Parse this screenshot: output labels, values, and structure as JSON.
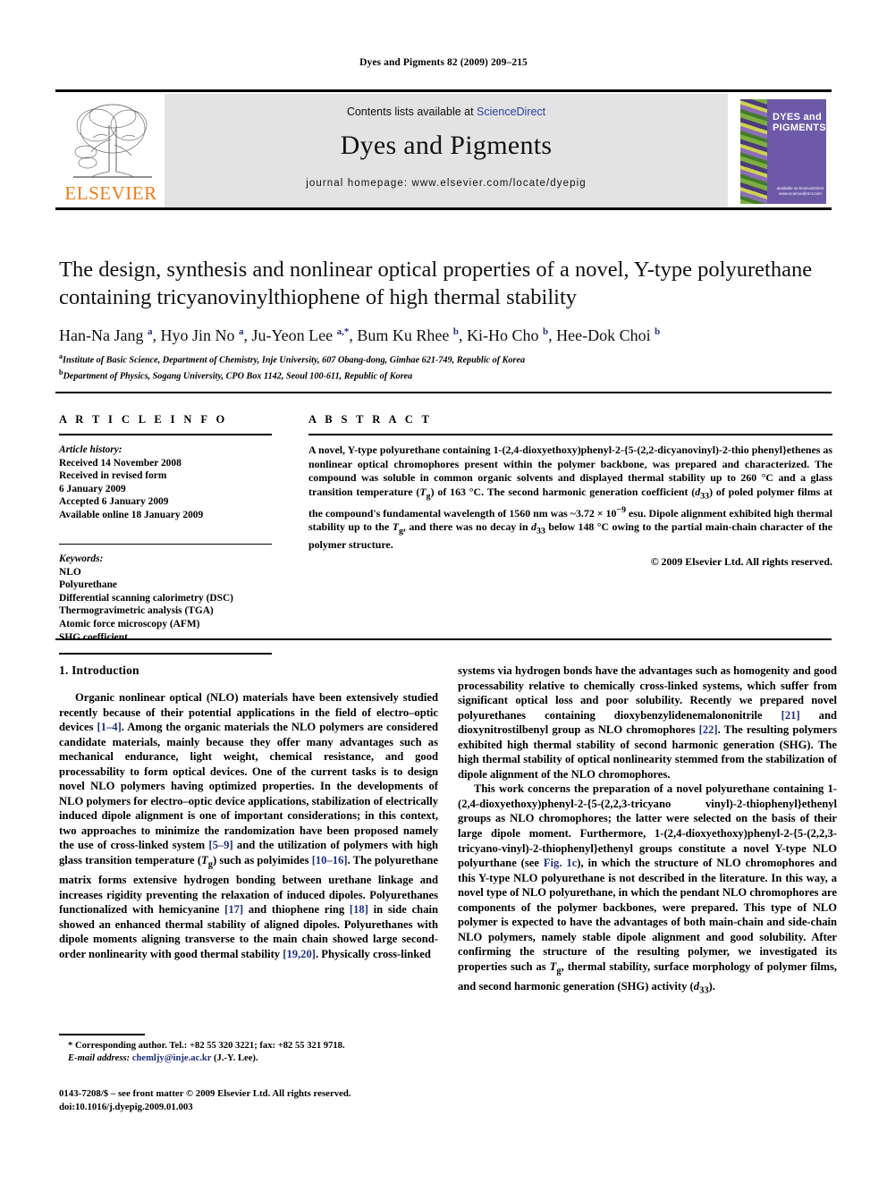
{
  "running_head": "Dyes and Pigments 82 (2009) 209–215",
  "masthead": {
    "contents_prefix": "Contents lists available at ",
    "sciencedirect": "ScienceDirect",
    "journal_name": "Dyes and Pigments",
    "homepage": "journal homepage: www.elsevier.com/locate/dyepig",
    "publisher_logo_text": "ELSEVIER",
    "cover_title": "DYES and PIGMENTS",
    "cover_sd_text": "available at ScienceDirect www.sciencedirect.com",
    "colors": {
      "sciencedirect_link": "#2b3fa0",
      "elsevier_orange": "#ef7c1a",
      "cover_purple": "#6c5aa8",
      "masthead_background": "#e3e3e3"
    }
  },
  "article": {
    "title": "The design, synthesis and nonlinear optical properties of a novel, Y-type polyurethane containing tricyanovinylthiophene of high thermal stability",
    "authors_html": "Han-Na Jang <sup>a</sup>, Hyo Jin No <sup>a</sup>, Ju-Yeon Lee <sup>a,*</sup>, Bum Ku Rhee <sup>b</sup>, Ki-Ho Cho <sup>b</sup>, Hee-Dok Choi <sup>b</sup>",
    "affiliation_a": "Institute of Basic Science, Department of Chemistry, Inje University, 607 Obang-dong, Gimhae 621-749, Republic of Korea",
    "affiliation_b": "Department of Physics, Sogang University, CPO Box 1142, Seoul 100-611, Republic of Korea"
  },
  "article_info": {
    "heading": "A R T I C L E    I N F O",
    "history_label": "Article history:",
    "history": [
      "Received 14 November 2008",
      "Received in revised form",
      "6 January 2009",
      "Accepted 6 January 2009",
      "Available online 18 January 2009"
    ],
    "keywords_label": "Keywords:",
    "keywords": [
      "NLO",
      "Polyurethane",
      "Differential scanning calorimetry (DSC)",
      "Thermogravimetric analysis (TGA)",
      "Atomic force microscopy (AFM)",
      "SHG coefficient"
    ]
  },
  "abstract": {
    "heading": "A B S T R A C T",
    "text_html": "A novel, Y-type polyurethane containing 1-(2,4-dioxyethoxy)phenyl-2-{5-(2,2-dicyanovinyl)-2-thio phenyl}ethenes as nonlinear optical chromophores present within the polymer backbone, was prepared and characterized. The compound was soluble in common organic solvents and displayed thermal stability up to 260 °C and a glass transition temperature (<em>T</em><sub>g</sub>) of 163 °C. The second harmonic generation coefficient (<em>d</em><sub>33</sub>) of poled polymer films at the compound's fundamental wavelength of 1560 nm was ~3.72 × 10<sup>−9</sup> esu. Dipole alignment exhibited high thermal stability up to the <em>T</em><sub>g</sub>, and there was no decay in <em>d</em><sub>33</sub> below 148 °C owing to the partial main-chain character of the polymer structure.",
    "copyright": "© 2009 Elsevier Ltd. All rights reserved."
  },
  "body": {
    "section_heading": "1.  Introduction",
    "left_paragraph_1_html": "Organic nonlinear optical (NLO) materials have been extensively studied recently because of their potential applications in the field of electro–optic devices <span class=\"ref\">[1–4]</span>. Among the organic materials the NLO polymers are considered candidate materials, mainly because they offer many advantages such as mechanical endurance, light weight, chemical resistance, and good processability to form optical devices. One of the current tasks is to design novel NLO polymers having optimized properties. In the developments of NLO polymers for electro–optic device applications, stabilization of electrically induced dipole alignment is one of important considerations; in this context, two approaches to minimize the randomization have been proposed namely the use of cross-linked system <span class=\"ref\">[5–9]</span> and the utilization of polymers with high glass transition temperature (<em>T</em><sub>g</sub>) such as polyimides <span class=\"ref\">[10–16]</span>. The polyurethane matrix forms extensive hydrogen bonding between urethane linkage and increases rigidity preventing the relaxation of induced dipoles. Polyurethanes functionalized with hemicyanine <span class=\"ref\">[17]</span> and thiophene ring <span class=\"ref\">[18]</span> in side chain showed an enhanced thermal stability of aligned dipoles. Polyurethanes with dipole moments aligning transverse to the main chain showed large second-order nonlinearity with good thermal stability <span class=\"ref\">[19,20]</span>. Physically cross-linked",
    "right_paragraph_1_html": "systems via hydrogen bonds have the advantages such as homogenity and good processability relative to chemically cross-linked systems, which suffer from significant optical loss and poor solubility. Recently we prepared novel polyurethanes containing dioxybenzylidenemalononitrile <span class=\"ref\">[21]</span> and dioxynitrostilbenyl group as NLO chromophores <span class=\"ref\">[22]</span>. The resulting polymers exhibited high thermal stability of second harmonic generation (SHG). The high thermal stability of optical nonlinearity stemmed from the stabilization of dipole alignment of the NLO chromophores.",
    "right_paragraph_2_html": "This work concerns the preparation of a novel polyurethane containing  1-(2,4-dioxyethoxy)phenyl-2-{5-(2,2,3-tricyano vinyl)-2-thiophenyl}ethenyl groups as NLO chromophores; the latter were selected on the basis of their large dipole moment. Furthermore,  1-(2,4-dioxyethoxy)phenyl-2-{5-(2,2,3-tricyano-vinyl)-2-thiophenyl}ethenyl groups constitute a novel Y-type NLO polyurthane (see <span class=\"ref\">Fig. 1c</span>), in which the structure of NLO chromophores and this Y-type NLO polyurethane is not described in the literature. In this way, a novel type of NLO polyurethane, in which the pendant NLO chromophores are components of the polymer backbones, were prepared. This type of NLO polymer is expected to have the advantages of both main-chain and side-chain NLO polymers, namely stable dipole alignment and good solubility. After confirming the structure of the resulting polymer, we investigated its properties such as <em>T</em><sub>g</sub>, thermal stability, surface morphology of polymer films, and second harmonic generation (SHG) activity (<em>d</em><sub>33</sub>)."
  },
  "footnotes": {
    "corresponding_html": "* Corresponding author. Tel.: +82 55 320 3221; fax: +82 55 321 9718.",
    "email_label": "E-mail address:",
    "email": "chemljy@inje.ac.kr",
    "email_owner": "(J.-Y. Lee).",
    "issn_line": "0143-7208/$ – see front matter © 2009 Elsevier Ltd. All rights reserved.",
    "doi_line": "doi:10.1016/j.dyepig.2009.01.003"
  }
}
